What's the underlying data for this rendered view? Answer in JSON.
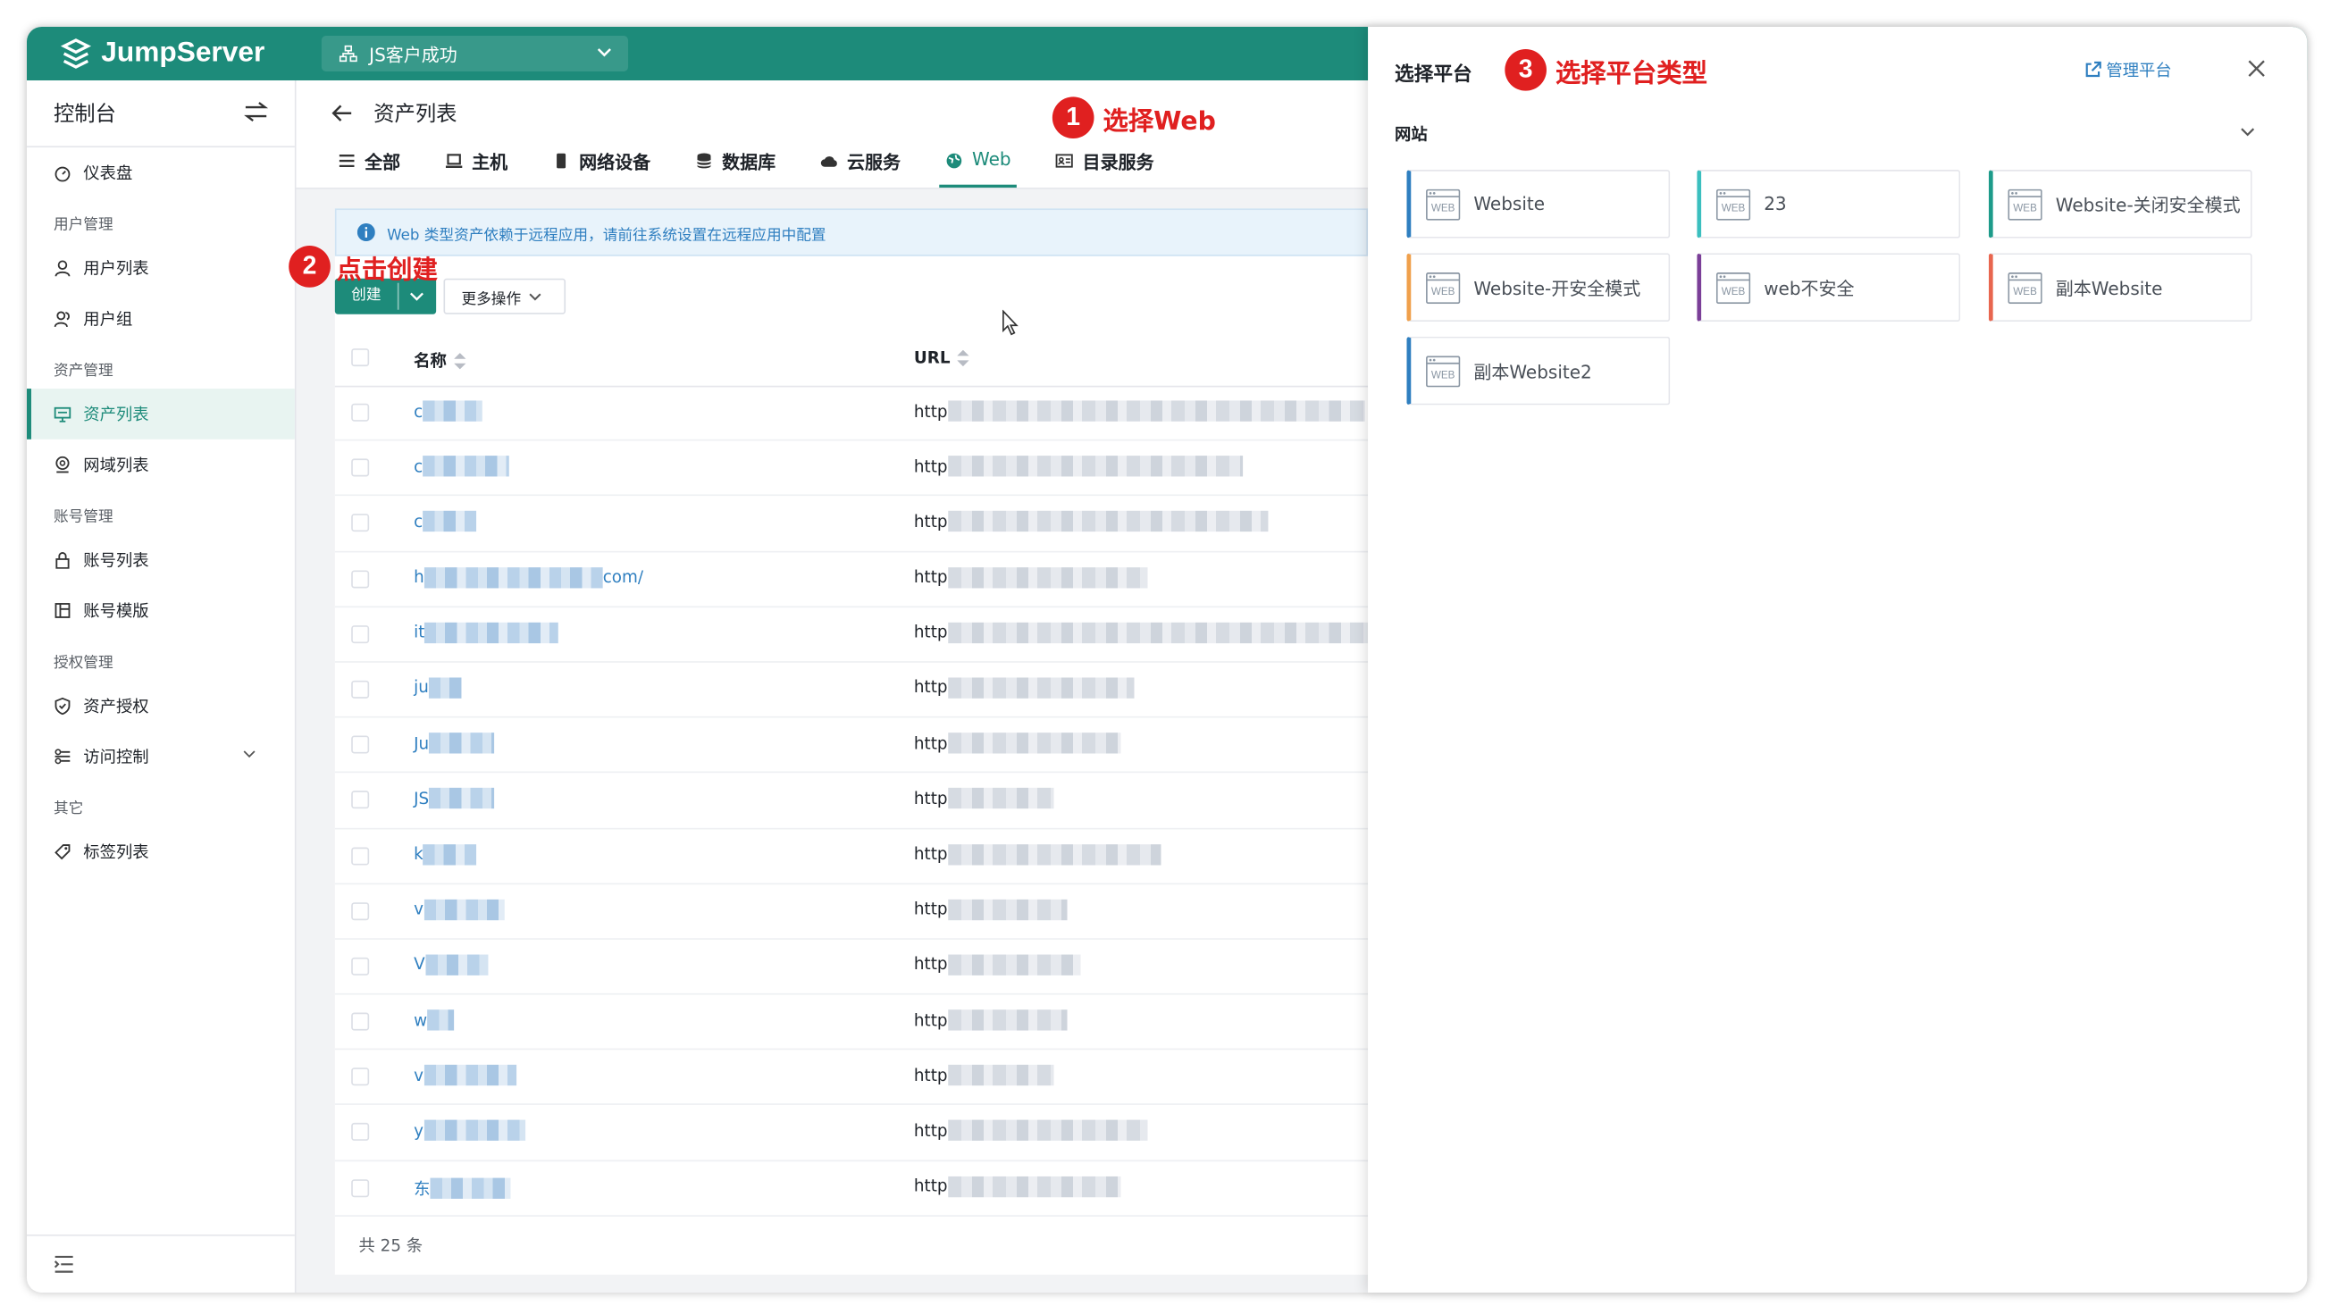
{
  "app": {
    "logo_text": "JumpServer",
    "org_name": "JS客户成功"
  },
  "sidebar": {
    "title": "控制台",
    "items": [
      {
        "type": "item",
        "label": "仪表盘",
        "icon": "dashboard-icon"
      },
      {
        "type": "group",
        "label": "用户管理"
      },
      {
        "type": "item",
        "label": "用户列表",
        "icon": "user-icon"
      },
      {
        "type": "item",
        "label": "用户组",
        "icon": "users-icon"
      },
      {
        "type": "group",
        "label": "资产管理"
      },
      {
        "type": "item",
        "label": "资产列表",
        "icon": "monitor-icon",
        "active": true
      },
      {
        "type": "item",
        "label": "网域列表",
        "icon": "location-icon"
      },
      {
        "type": "group",
        "label": "账号管理"
      },
      {
        "type": "item",
        "label": "账号列表",
        "icon": "lock-icon"
      },
      {
        "type": "item",
        "label": "账号模版",
        "icon": "template-icon"
      },
      {
        "type": "group",
        "label": "授权管理"
      },
      {
        "type": "item",
        "label": "资产授权",
        "icon": "shield-icon"
      },
      {
        "type": "item",
        "label": "访问控制",
        "icon": "acl-icon",
        "expandable": true
      },
      {
        "type": "group",
        "label": "其它"
      },
      {
        "type": "item",
        "label": "标签列表",
        "icon": "tag-icon"
      }
    ]
  },
  "page": {
    "title": "资产列表",
    "tabs": [
      {
        "label": "全部",
        "icon": "list-icon"
      },
      {
        "label": "主机",
        "icon": "host-icon"
      },
      {
        "label": "网络设备",
        "icon": "device-icon"
      },
      {
        "label": "数据库",
        "icon": "database-icon"
      },
      {
        "label": "云服务",
        "icon": "cloud-icon"
      },
      {
        "label": "Web",
        "icon": "globe-icon",
        "active": true
      },
      {
        "label": "目录服务",
        "icon": "directory-icon"
      }
    ],
    "notice": "Web 类型资产依赖于远程应用，请前往系统设置在远程应用中配置",
    "create_label": "创建",
    "more_label": "更多操作",
    "columns": {
      "name": "名称",
      "url": "URL"
    },
    "rows": [
      {
        "name": "c",
        "url": "http"
      },
      {
        "name": "c",
        "url": "http"
      },
      {
        "name": "c",
        "url": "http"
      },
      {
        "name": "h",
        "name_tail": "com/",
        "url": "http"
      },
      {
        "name": "it",
        "url": "http"
      },
      {
        "name": "ju",
        "url": "http"
      },
      {
        "name": "Ju",
        "url": "http"
      },
      {
        "name": "JS",
        "url": "http"
      },
      {
        "name": "k",
        "url": "http"
      },
      {
        "name": "v",
        "url": "http"
      },
      {
        "name": "V",
        "url": "http"
      },
      {
        "name": "w",
        "url": "http"
      },
      {
        "name": "v",
        "url": "http"
      },
      {
        "name": "y",
        "url": "http"
      },
      {
        "name": "东",
        "url": "http"
      }
    ],
    "total_text": "共 25 条"
  },
  "drawer": {
    "title": "选择平台",
    "manage_link": "管理平台",
    "section": "网站",
    "platforms": [
      {
        "label": "Website",
        "accent": "#2f7fc0"
      },
      {
        "label": "23",
        "accent": "#3bbfbf"
      },
      {
        "label": "Website-关闭安全模式",
        "accent": "#1d9b8a"
      },
      {
        "label": "Website-开安全模式",
        "accent": "#f0a04b"
      },
      {
        "label": "web不安全",
        "accent": "#7b3f98"
      },
      {
        "label": "副本Website",
        "accent": "#e8664f"
      },
      {
        "label": "副本Website2",
        "accent": "#2f7fc0"
      }
    ]
  },
  "annotations": [
    {
      "num": "1",
      "text": "选择Web"
    },
    {
      "num": "2",
      "text": "点击创建"
    },
    {
      "num": "3",
      "text": "选择平台类型"
    }
  ],
  "colors": {
    "brand": "#1d8b7a",
    "link": "#2f7fc0",
    "annotation": "#e02020"
  }
}
